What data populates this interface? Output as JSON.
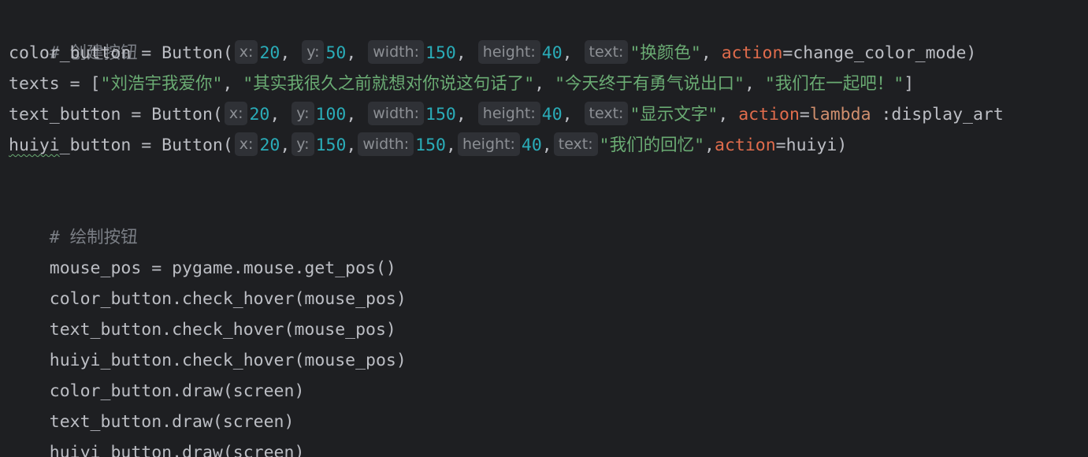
{
  "lines": {
    "c1": "# 创建按钮",
    "l1": {
      "a": "color_button = Button(",
      "hx": "x:",
      "vx": "20",
      "s1": ", ",
      "hy": "y:",
      "vy": "50",
      "s2": ", ",
      "hw": "width:",
      "vw": "150",
      "s3": ", ",
      "hh": "height:",
      "vh": "40",
      "s4": ", ",
      "ht": "text:",
      "vt": "\"换颜色\"",
      "s5": ", ",
      "kw": "action",
      "eq": "=",
      "rest": "change_color_mode)"
    },
    "l2": {
      "a": "texts = [",
      "s1": "\"刘浩宇我爱你\"",
      "c1": ", ",
      "s2": "\"其实我很久之前就想对你说这句话了\"",
      "c2": ", ",
      "s3": "\"今天终于有勇气说出口\"",
      "c3": ", ",
      "s4": "\"我们在一起吧！\"",
      "end": "]"
    },
    "l3": {
      "a": "text_button = Button(",
      "hx": "x:",
      "vx": "20",
      "s1": ", ",
      "hy": "y:",
      "vy": "100",
      "s2": ", ",
      "hw": "width:",
      "vw": "150",
      "s3": ", ",
      "hh": "height:",
      "vh": "40",
      "s4": ", ",
      "ht": "text:",
      "vt": "\"显示文字\"",
      "s5": ", ",
      "kw": "action",
      "eq": "=",
      "lam": "lambda",
      "rest": " :display_art"
    },
    "l4": {
      "a0": "huiyi",
      "a": "_button = Button(",
      "hx": "x:",
      "vx": "20",
      "s1": ",",
      "hy": "y:",
      "vy": "150",
      "s2": ",",
      "hw": "width:",
      "vw": "150",
      "s3": ",",
      "hh": "height:",
      "vh": "40",
      "s4": ",",
      "ht": "text:",
      "vt": "\"我们的回忆\"",
      "s5": ",",
      "kw": "action",
      "eq": "=",
      "rest": "huiyi)"
    },
    "blank": " ",
    "c2": "# 绘制按钮",
    "l5": "mouse_pos = pygame.mouse.get_pos()",
    "l6": "color_button.check_hover(mouse_pos)",
    "l7": "text_button.check_hover(mouse_pos)",
    "l8": "huiyi_button.check_hover(mouse_pos)",
    "l9": "color_button.draw(screen)",
    "l10": "text_button.draw(screen)",
    "l11": "huiyi_button.draw(screen)"
  },
  "colors": {
    "background": "#1e1f22",
    "text": "#bcbec4",
    "comment": "#7a7e85",
    "number": "#2aacb8",
    "string": "#6aab73",
    "keyword_arg": "#e06c4c",
    "keyword": "#cf8e6d",
    "inlay_hint_bg": "#2f3136"
  }
}
